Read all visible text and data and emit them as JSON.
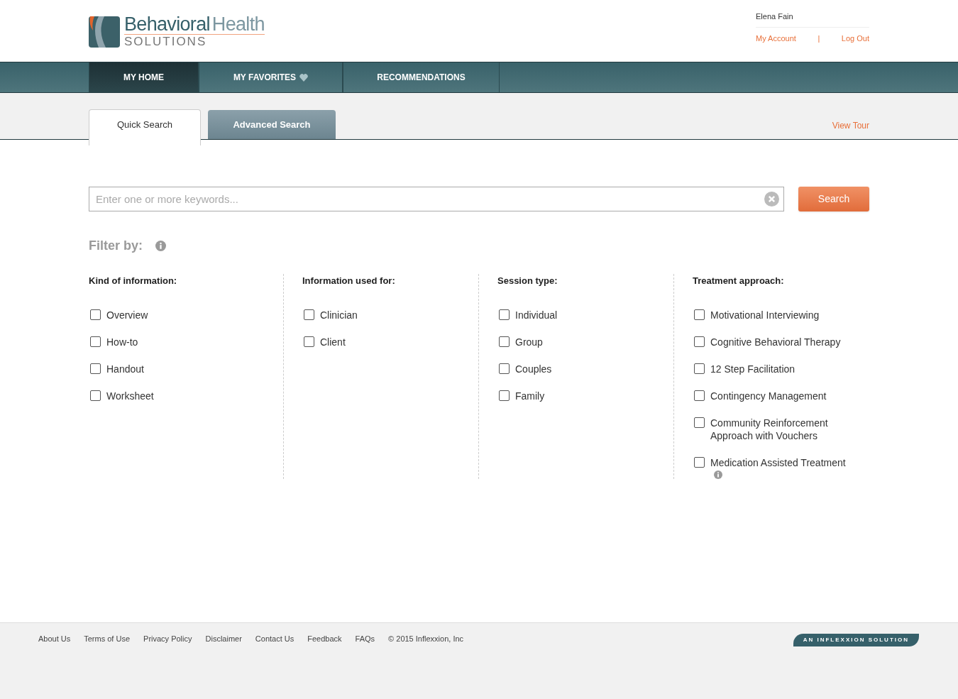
{
  "logo": {
    "word_1": "Behavioral",
    "word_2": "Health",
    "subtitle": "SOLUTIONS"
  },
  "user": {
    "name": "Elena Fain",
    "links": [
      "My Account",
      "Log Out"
    ],
    "separator": "|"
  },
  "nav": [
    {
      "label": "MY HOME",
      "selected": true,
      "heart": false
    },
    {
      "label": "MY FAVORITES",
      "selected": false,
      "heart": true
    },
    {
      "label": "RECOMMENDATIONS",
      "selected": false,
      "heart": false
    }
  ],
  "tabs": [
    {
      "label": "Quick Search",
      "selected": true
    },
    {
      "label": "Advanced Search",
      "selected": false
    }
  ],
  "view_tour": "View Tour",
  "search": {
    "placeholder": "Enter one or more keywords...",
    "button": "Search"
  },
  "filter_title": "Filter by:",
  "filters": [
    {
      "title": "Kind of information:",
      "options": [
        {
          "label": "Overview",
          "checked": false,
          "info": false
        },
        {
          "label": "How-to",
          "checked": false,
          "info": false
        },
        {
          "label": "Handout",
          "checked": false,
          "info": false
        },
        {
          "label": "Worksheet",
          "checked": false,
          "info": false
        }
      ]
    },
    {
      "title": "Information used for:",
      "options": [
        {
          "label": "Clinician",
          "checked": false,
          "info": false
        },
        {
          "label": "Client",
          "checked": false,
          "info": false
        }
      ]
    },
    {
      "title": "Session type:",
      "options": [
        {
          "label": "Individual",
          "checked": false,
          "info": false
        },
        {
          "label": "Group",
          "checked": false,
          "info": false
        },
        {
          "label": "Couples",
          "checked": false,
          "info": false
        },
        {
          "label": "Family",
          "checked": false,
          "info": false
        }
      ]
    },
    {
      "title": "Treatment approach:",
      "options": [
        {
          "label": "Motivational Interviewing",
          "checked": false,
          "info": false
        },
        {
          "label": "Cognitive Behavioral Therapy",
          "checked": false,
          "info": false
        },
        {
          "label": "12 Step Facilitation",
          "checked": false,
          "info": false
        },
        {
          "label": "Contingency Management",
          "checked": false,
          "info": false
        },
        {
          "label": "Community Reinforcement Approach with Vouchers",
          "checked": false,
          "info": false
        },
        {
          "label": "Medication Assisted Treatment",
          "checked": false,
          "info": true
        }
      ]
    }
  ],
  "footer": {
    "links": [
      "About Us",
      "Terms of Use",
      "Privacy Policy",
      "Disclaimer",
      "Contact Us",
      "Feedback",
      "FAQs"
    ],
    "copyright": "© 2015 Inflexxion, Inc",
    "badge": "AN INFLEXXION SOLUTION"
  }
}
